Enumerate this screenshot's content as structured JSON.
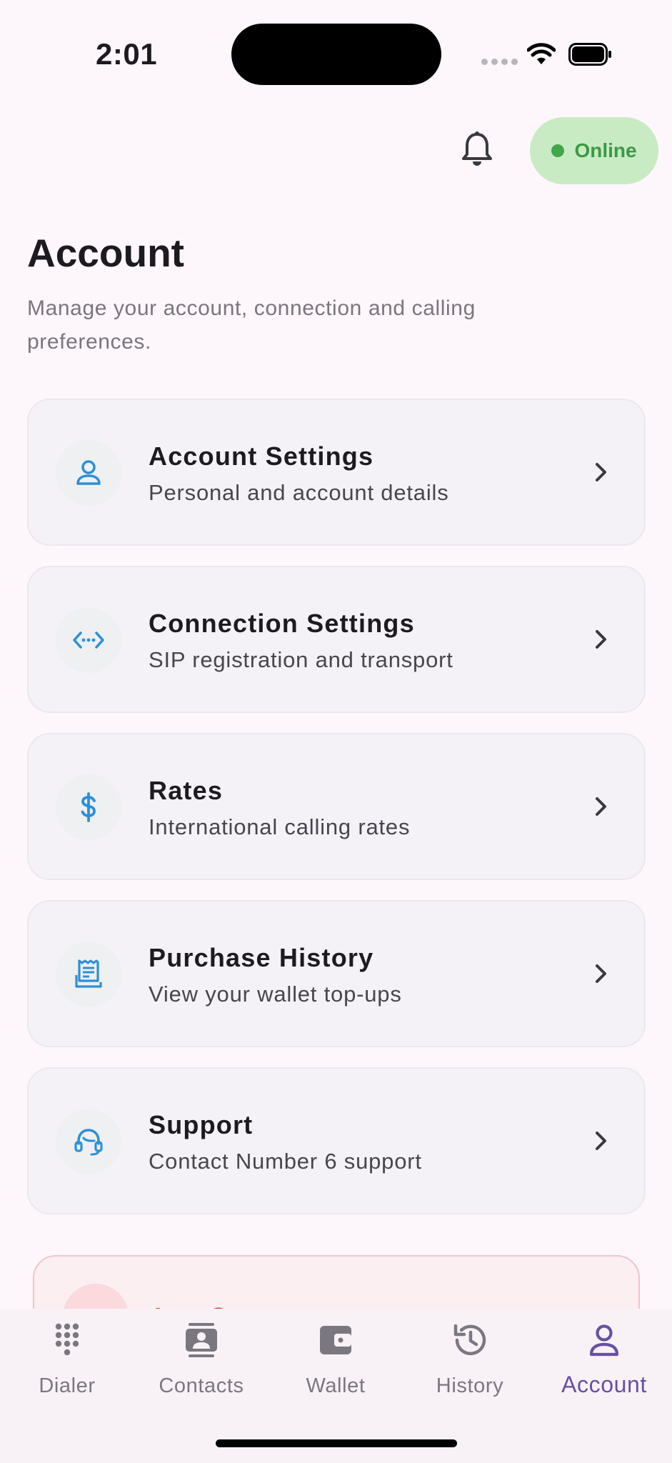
{
  "status_bar": {
    "time": "2:01"
  },
  "top_bar": {
    "status_label": "Online"
  },
  "header": {
    "title": "Account",
    "subtitle": "Manage your account, connection and calling preferences."
  },
  "menu": [
    {
      "title": "Account Settings",
      "subtitle": "Personal and account details",
      "icon": "person-icon"
    },
    {
      "title": "Connection Settings",
      "subtitle": "SIP registration and transport",
      "icon": "code-arrows-icon"
    },
    {
      "title": "Rates",
      "subtitle": "International calling rates",
      "icon": "dollar-icon"
    },
    {
      "title": "Purchase History",
      "subtitle": "View your wallet top-ups",
      "icon": "receipt-icon"
    },
    {
      "title": "Support",
      "subtitle": "Contact Number 6 support",
      "icon": "headset-icon"
    }
  ],
  "logout": {
    "label": "Log Out"
  },
  "nav": [
    {
      "label": "Dialer",
      "icon": "dialpad-icon"
    },
    {
      "label": "Contacts",
      "icon": "contacts-icon"
    },
    {
      "label": "Wallet",
      "icon": "wallet-icon"
    },
    {
      "label": "History",
      "icon": "history-icon"
    },
    {
      "label": "Account",
      "icon": "account-icon",
      "active": true
    }
  ],
  "colors": {
    "accent": "#6750a4",
    "icon_blue": "#2b90d9",
    "online_green": "#3fa84a",
    "online_bg": "#c9ebc3",
    "danger": "#d93a3a"
  }
}
